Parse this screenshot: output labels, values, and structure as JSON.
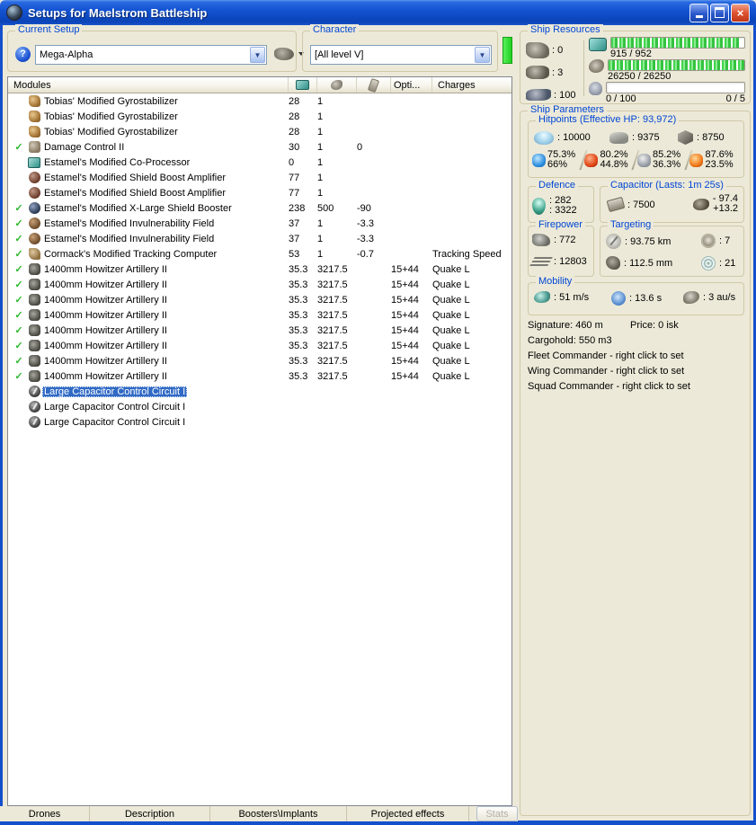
{
  "window": {
    "title": "Setups for Maelstrom Battleship"
  },
  "current_setup": {
    "label": "Current Setup",
    "value": "Mega-Alpha",
    "help_glyph": "?"
  },
  "character": {
    "label": "Character",
    "value": "[All level V]"
  },
  "ship_resources": {
    "label": "Ship Resources",
    "slots": {
      "turrets": ": 0",
      "launchers": ": 3",
      "rigs": ": 100"
    },
    "bars": [
      {
        "name": "cpu",
        "text": "915 / 952",
        "fill_pct": 96
      },
      {
        "name": "powergrid",
        "text": "26250 / 26250",
        "fill_pct": 100
      },
      {
        "name": "drones",
        "text": "0 / 100",
        "right_text": "0 / 5",
        "fill_pct": 0
      }
    ]
  },
  "modules": {
    "check_glyph": "✓",
    "header": {
      "title": "Modules",
      "opti": "Opti...",
      "charges": "Charges"
    },
    "rows": [
      {
        "check": false,
        "icon": "gyrostabilizer",
        "name": "Tobias' Modified Gyrostabilizer",
        "cpu": "28",
        "pg": "1",
        "cap": "",
        "opti": "",
        "charges": ""
      },
      {
        "check": false,
        "icon": "gyrostabilizer",
        "name": "Tobias' Modified Gyrostabilizer",
        "cpu": "28",
        "pg": "1",
        "cap": "",
        "opti": "",
        "charges": ""
      },
      {
        "check": false,
        "icon": "gyrostabilizer",
        "name": "Tobias' Modified Gyrostabilizer",
        "cpu": "28",
        "pg": "1",
        "cap": "",
        "opti": "",
        "charges": ""
      },
      {
        "check": true,
        "icon": "damage-control",
        "name": "Damage Control II",
        "cpu": "30",
        "pg": "1",
        "cap": "0",
        "opti": "",
        "charges": ""
      },
      {
        "check": false,
        "icon": "co-processor",
        "name": "Estamel's Modified Co-Processor",
        "cpu": "0",
        "pg": "1",
        "cap": "",
        "opti": "",
        "charges": ""
      },
      {
        "check": false,
        "icon": "shield-boost-amplifier",
        "name": "Estamel's Modified Shield Boost Amplifier",
        "cpu": "77",
        "pg": "1",
        "cap": "",
        "opti": "",
        "charges": ""
      },
      {
        "check": false,
        "icon": "shield-boost-amplifier",
        "name": "Estamel's Modified Shield Boost Amplifier",
        "cpu": "77",
        "pg": "1",
        "cap": "",
        "opti": "",
        "charges": ""
      },
      {
        "check": true,
        "icon": "shield-booster",
        "name": "Estamel's Modified X-Large Shield Booster",
        "cpu": "238",
        "pg": "500",
        "cap": "-90",
        "opti": "",
        "charges": ""
      },
      {
        "check": true,
        "icon": "invulnerability-field",
        "name": "Estamel's Modified Invulnerability Field",
        "cpu": "37",
        "pg": "1",
        "cap": "-3.3",
        "opti": "",
        "charges": ""
      },
      {
        "check": true,
        "icon": "invulnerability-field",
        "name": "Estamel's Modified Invulnerability Field",
        "cpu": "37",
        "pg": "1",
        "cap": "-3.3",
        "opti": "",
        "charges": ""
      },
      {
        "check": true,
        "icon": "tracking-computer",
        "name": "Cormack's Modified Tracking Computer",
        "cpu": "53",
        "pg": "1",
        "cap": "-0.7",
        "opti": "",
        "charges": "Tracking Speed"
      },
      {
        "check": true,
        "icon": "artillery",
        "name": "1400mm Howitzer Artillery II",
        "cpu": "35.3",
        "pg": "3217.5",
        "cap": "",
        "opti": "15+44",
        "charges": "Quake L"
      },
      {
        "check": true,
        "icon": "artillery",
        "name": "1400mm Howitzer Artillery II",
        "cpu": "35.3",
        "pg": "3217.5",
        "cap": "",
        "opti": "15+44",
        "charges": "Quake L"
      },
      {
        "check": true,
        "icon": "artillery",
        "name": "1400mm Howitzer Artillery II",
        "cpu": "35.3",
        "pg": "3217.5",
        "cap": "",
        "opti": "15+44",
        "charges": "Quake L"
      },
      {
        "check": true,
        "icon": "artillery",
        "name": "1400mm Howitzer Artillery II",
        "cpu": "35.3",
        "pg": "3217.5",
        "cap": "",
        "opti": "15+44",
        "charges": "Quake L"
      },
      {
        "check": true,
        "icon": "artillery",
        "name": "1400mm Howitzer Artillery II",
        "cpu": "35.3",
        "pg": "3217.5",
        "cap": "",
        "opti": "15+44",
        "charges": "Quake L"
      },
      {
        "check": true,
        "icon": "artillery",
        "name": "1400mm Howitzer Artillery II",
        "cpu": "35.3",
        "pg": "3217.5",
        "cap": "",
        "opti": "15+44",
        "charges": "Quake L"
      },
      {
        "check": true,
        "icon": "artillery",
        "name": "1400mm Howitzer Artillery II",
        "cpu": "35.3",
        "pg": "3217.5",
        "cap": "",
        "opti": "15+44",
        "charges": "Quake L"
      },
      {
        "check": true,
        "icon": "artillery",
        "name": "1400mm Howitzer Artillery II",
        "cpu": "35.3",
        "pg": "3217.5",
        "cap": "",
        "opti": "15+44",
        "charges": "Quake L"
      },
      {
        "check": false,
        "icon": "cap-circuit",
        "name": "Large Capacitor Control Circuit I",
        "cpu": "",
        "pg": "",
        "cap": "",
        "opti": "",
        "charges": "",
        "selected": true
      },
      {
        "check": false,
        "icon": "cap-circuit",
        "name": "Large Capacitor Control Circuit I",
        "cpu": "",
        "pg": "",
        "cap": "",
        "opti": "",
        "charges": ""
      },
      {
        "check": false,
        "icon": "cap-circuit",
        "name": "Large Capacitor Control Circuit I",
        "cpu": "",
        "pg": "",
        "cap": "",
        "opti": "",
        "charges": ""
      }
    ]
  },
  "tabs": [
    {
      "id": "drones",
      "label": "Drones"
    },
    {
      "id": "description",
      "label": "Description"
    },
    {
      "id": "boosters-implants",
      "label": "Boosters\\Implants"
    },
    {
      "id": "projected-effects",
      "label": "Projected effects"
    }
  ],
  "stats_button": "Stats",
  "parameters": {
    "label": "Ship Parameters",
    "hitpoints": {
      "label": "Hitpoints (Effective HP: 93,972)",
      "shield": ": 10000",
      "armor": ": 9375",
      "structure": ": 8750",
      "resists": [
        {
          "type": "em",
          "a": "75.3%",
          "b": "66%"
        },
        {
          "type": "thermal",
          "a": "80.2%",
          "b": "44.8%"
        },
        {
          "type": "kinetic",
          "a": "85.2%",
          "b": "36.3%"
        },
        {
          "type": "explosive",
          "a": "87.6%",
          "b": "23.5%"
        }
      ]
    },
    "defence": {
      "label": "Defence",
      "v1": ": 282",
      "v2": ": 3322"
    },
    "capacitor": {
      "label": "Capacitor (Lasts: 1m 25s)",
      "amount": ": 7500",
      "delta_neg": "- 97.4",
      "delta_pos": "+13.2"
    },
    "firepower": {
      "label": "Firepower",
      "dps": ": 772",
      "volley": ": 12803"
    },
    "targeting": {
      "label": "Targeting",
      "range": ": 93.75 km",
      "scan_res": ": 112.5 mm",
      "max_targets": ": 7",
      "sensor_strength": ": 21"
    },
    "mobility": {
      "label": "Mobility",
      "speed": ": 51 m/s",
      "align": ": 13.6 s",
      "warp": ": 3 au/s"
    },
    "info": {
      "signature": "Signature: 460 m",
      "price": "Price: 0 isk",
      "cargohold": "Cargohold: 550 m3",
      "fleet": "Fleet Commander - right click to set",
      "wing": "Wing Commander - right click to set",
      "squad": "Squad Commander - right click to set"
    }
  }
}
